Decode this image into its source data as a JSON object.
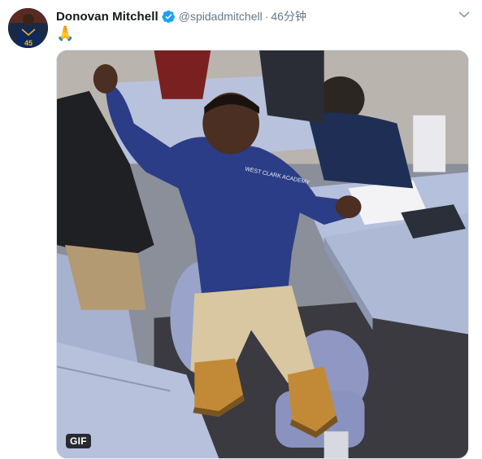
{
  "tweet": {
    "display_name": "Donovan Mitchell",
    "handle": "@spidadmitchell",
    "separator": "·",
    "timestamp": "46分钟",
    "body_emoji": "🙏",
    "media_badge": "GIF",
    "avatar_jersey_number": "45",
    "shirt_print": "WEST CLARK ACADEMY"
  },
  "icons": {
    "verified": "verified-badge-icon",
    "caret": "chevron-down-icon"
  },
  "colors": {
    "name": "#14171a",
    "muted": "#657786",
    "verified": "#1da1f2",
    "badge_bg": "#000000",
    "badge_text": "#ffffff"
  }
}
